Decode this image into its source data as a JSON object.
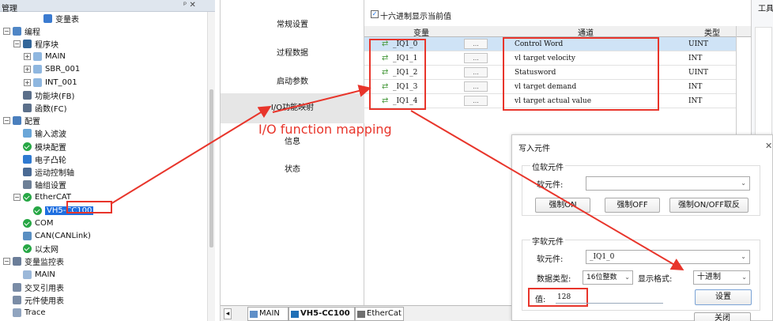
{
  "project_panel": {
    "title": "管理",
    "pin_close": "ᵖ ✕",
    "items": [
      {
        "label": "变量表",
        "indent": 3,
        "icon": "variable-table-icon"
      },
      {
        "label": "编程",
        "indent": 0,
        "icon": "program-icon",
        "expander": "−"
      },
      {
        "label": "程序块",
        "indent": 1,
        "icon": "program-block-icon",
        "expander": "−"
      },
      {
        "label": "MAIN",
        "indent": 2,
        "icon": "main-block-icon",
        "expander": "+"
      },
      {
        "label": "SBR_001",
        "indent": 2,
        "icon": "sbr-block-icon",
        "expander": "+"
      },
      {
        "label": "INT_001",
        "indent": 2,
        "icon": "int-block-icon",
        "expander": "+"
      },
      {
        "label": "功能块(FB)",
        "indent": 1,
        "icon": "fb-icon"
      },
      {
        "label": "函数(FC)",
        "indent": 1,
        "icon": "fc-icon"
      },
      {
        "label": "配置",
        "indent": 0,
        "icon": "config-icon",
        "expander": "−"
      },
      {
        "label": "输入滤波",
        "indent": 1,
        "icon": "input-filter-icon"
      },
      {
        "label": "模块配置",
        "indent": 1,
        "icon": "check-icon"
      },
      {
        "label": "电子凸轮",
        "indent": 1,
        "icon": "cam-icon"
      },
      {
        "label": "运动控制轴",
        "indent": 1,
        "icon": "axis-icon"
      },
      {
        "label": "轴组设置",
        "indent": 1,
        "icon": "axis-group-icon"
      },
      {
        "label": "EtherCAT",
        "indent": 1,
        "icon": "check-icon",
        "expander": "−"
      },
      {
        "label": "VH5-CC100",
        "indent": 2,
        "icon": "check-icon",
        "selected": true
      },
      {
        "label": "COM",
        "indent": 1,
        "icon": "check-icon"
      },
      {
        "label": "CAN(CANLink)",
        "indent": 1,
        "icon": "can-icon"
      },
      {
        "label": "以太网",
        "indent": 1,
        "icon": "check-icon"
      },
      {
        "label": "变量监控表",
        "indent": 0,
        "icon": "monitor-icon",
        "expander": "−"
      },
      {
        "label": "MAIN",
        "indent": 1,
        "icon": "monitor-main-icon"
      },
      {
        "label": "交叉引用表",
        "indent": 0,
        "icon": "cross-ref-icon"
      },
      {
        "label": "元件使用表",
        "indent": 0,
        "icon": "element-usage-icon"
      },
      {
        "label": "Trace",
        "indent": 0,
        "icon": "trace-icon"
      }
    ]
  },
  "side_tabs": [
    "常规设置",
    "过程数据",
    "启动参数",
    "I/O功能映射",
    "信息",
    "状态"
  ],
  "grid": {
    "hex_checkbox_label": "十六进制显示当前值",
    "headers": {
      "variable": "变量",
      "channel": "通道",
      "type": "类型"
    },
    "rows": [
      {
        "var": "_IQ1_0",
        "dots": "...",
        "channel": "Control Word",
        "type": "UINT"
      },
      {
        "var": "_IQ1_1",
        "dots": "...",
        "channel": "vl target velocity",
        "type": "INT"
      },
      {
        "var": "_IQ1_2",
        "dots": "...",
        "channel": "Statusword",
        "type": "UINT"
      },
      {
        "var": "_IQ1_3",
        "dots": "...",
        "channel": "vl target demand",
        "type": "INT"
      },
      {
        "var": "_IQ1_4",
        "dots": "...",
        "channel": "vl target actual value",
        "type": "INT"
      }
    ]
  },
  "annotation": {
    "text": "I/O function mapping",
    "color": "#e8352b"
  },
  "bottom_tabs": [
    "MAIN",
    "VH5-CC100",
    "EtherCat"
  ],
  "right_panel_title": "工具",
  "dialog": {
    "title": "写入元件",
    "close": "✕",
    "bit_group": "位软元件",
    "bit_element_label": "软元件:",
    "bit_element_value": "",
    "btn_force_on": "强制ON",
    "btn_force_off": "强制OFF",
    "btn_force_toggle": "强制ON/OFF取反",
    "word_group": "字软元件",
    "word_element_label": "软元件:",
    "word_element_value": "_IQ1_0",
    "data_type_label": "数据类型:",
    "data_type_value": "16位整数",
    "display_format_label": "显示格式:",
    "display_format_value": "十进制",
    "value_label": "值:",
    "value_input": "128",
    "btn_set": "设置",
    "btn_close": "关闭"
  }
}
